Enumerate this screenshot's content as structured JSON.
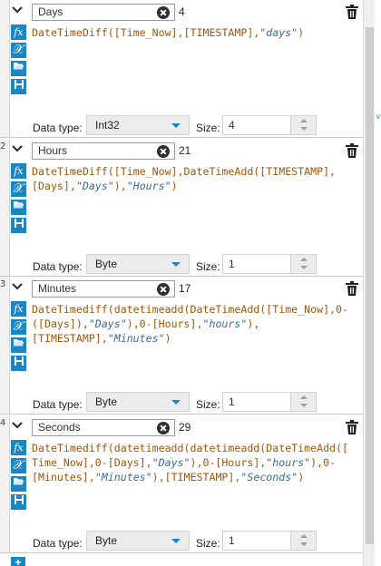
{
  "labels": {
    "data_type": "Data type:",
    "size": "Size:"
  },
  "icons": {
    "formula": "fx",
    "sigma": "𝒳"
  },
  "colors": {
    "accent": "#1a86c4",
    "expression": "#a0560a",
    "string_literal": "#3f6b8a"
  },
  "fields": [
    {
      "index": "",
      "name": "Days",
      "number": "4",
      "expression": [
        {
          "t": "DateTimeDiff([Time_Now],[TIMESTAMP],",
          "k": "p"
        },
        {
          "t": "\"days\"",
          "k": "s"
        },
        {
          "t": ")",
          "k": "p"
        }
      ],
      "data_type": "Int32",
      "size": "4"
    },
    {
      "index": "2",
      "name": "Hours",
      "number": "21",
      "expression": [
        {
          "t": "DateTimeDiff([Time_Now],DateTimeAdd([TIMESTAMP],\n[Days],",
          "k": "p"
        },
        {
          "t": "\"Days\"",
          "k": "s"
        },
        {
          "t": "),",
          "k": "p"
        },
        {
          "t": "\"Hours\"",
          "k": "s"
        },
        {
          "t": ")",
          "k": "p"
        }
      ],
      "data_type": "Byte",
      "size": "1"
    },
    {
      "index": "3",
      "name": "Minutes",
      "number": "17",
      "expression": [
        {
          "t": "DateTimediff(datetimeadd(DateTimeAdd([Time_Now],0-\n([Days]),",
          "k": "p"
        },
        {
          "t": "\"Days\"",
          "k": "s"
        },
        {
          "t": "),0-[Hours],",
          "k": "p"
        },
        {
          "t": "\"hours\"",
          "k": "s"
        },
        {
          "t": "),\n[TIMESTAMP],",
          "k": "p"
        },
        {
          "t": "\"Minutes\"",
          "k": "s"
        },
        {
          "t": ")",
          "k": "p"
        }
      ],
      "data_type": "Byte",
      "size": "1"
    },
    {
      "index": "4",
      "name": "Seconds",
      "number": "29",
      "expression": [
        {
          "t": "DateTimediff(datetimeadd(datetimeadd(DateTimeAdd([\nTime_Now],0-[Days],",
          "k": "p"
        },
        {
          "t": "\"Days\"",
          "k": "s"
        },
        {
          "t": "),0-[Hours],",
          "k": "p"
        },
        {
          "t": "\"hours\"",
          "k": "s"
        },
        {
          "t": "),0-\n[Minutes],",
          "k": "p"
        },
        {
          "t": "\"Minutes\"",
          "k": "s"
        },
        {
          "t": "),[TIMESTAMP],",
          "k": "p"
        },
        {
          "t": "\"Seconds\"",
          "k": "s"
        },
        {
          "t": ")",
          "k": "p"
        }
      ],
      "data_type": "Byte",
      "size": "1"
    }
  ],
  "footer": {
    "add_label": "+"
  }
}
